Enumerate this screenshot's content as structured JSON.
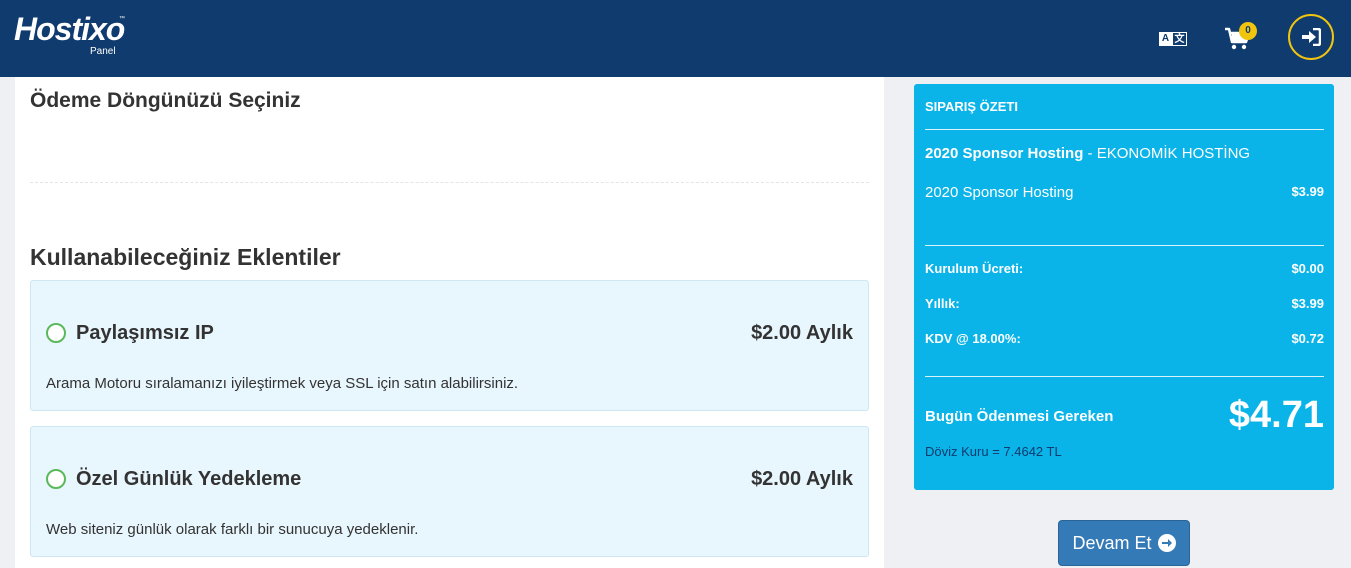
{
  "header": {
    "logo_text": "Hostixo",
    "logo_tm": "™",
    "logo_sub": "Panel",
    "lang_left": "A",
    "lang_right": "文",
    "cart_count": "0",
    "colors": {
      "bar": "#0f3b6e",
      "accent": "#f1c40f"
    }
  },
  "main": {
    "page_title": "Ödeme Döngünüzü Seçiniz",
    "section_title": "Kullanabileceğiniz Eklentiler",
    "addons": [
      {
        "name": "Paylaşımsız IP",
        "price": "$2.00 Aylık",
        "description": "Arama Motoru sıralamanızı iyileştirmek veya SSL için satın alabilirsiniz.",
        "selected": false
      },
      {
        "name": "Özel Günlük Yedekleme",
        "price": "$2.00 Aylık",
        "description": "Web siteniz günlük olarak farklı bir sunucuya yedeklenir.",
        "selected": false
      }
    ]
  },
  "summary": {
    "title": "SIPARIŞ ÖZETI",
    "product_group": "2020 Sponsor Hosting",
    "product_sep": " - ",
    "product_plan": "EKONOMİK HOSTİNG",
    "line_item": {
      "label": "2020 Sponsor Hosting",
      "value": "$3.99"
    },
    "setup_fee": {
      "label": "Kurulum Ücreti:",
      "value": "$0.00"
    },
    "annual": {
      "label": "Yıllık:",
      "value": "$3.99"
    },
    "tax": {
      "label": "KDV @ 18.00%:",
      "value": "$0.72"
    },
    "due_label": "Bugün Ödenmesi Gereken",
    "due_amount": "$4.71",
    "exchange_rate": "Döviz Kuru = 7.4642 TL",
    "colors": {
      "background": "#0ab4e8"
    }
  },
  "actions": {
    "continue_label": "Devam Et"
  }
}
